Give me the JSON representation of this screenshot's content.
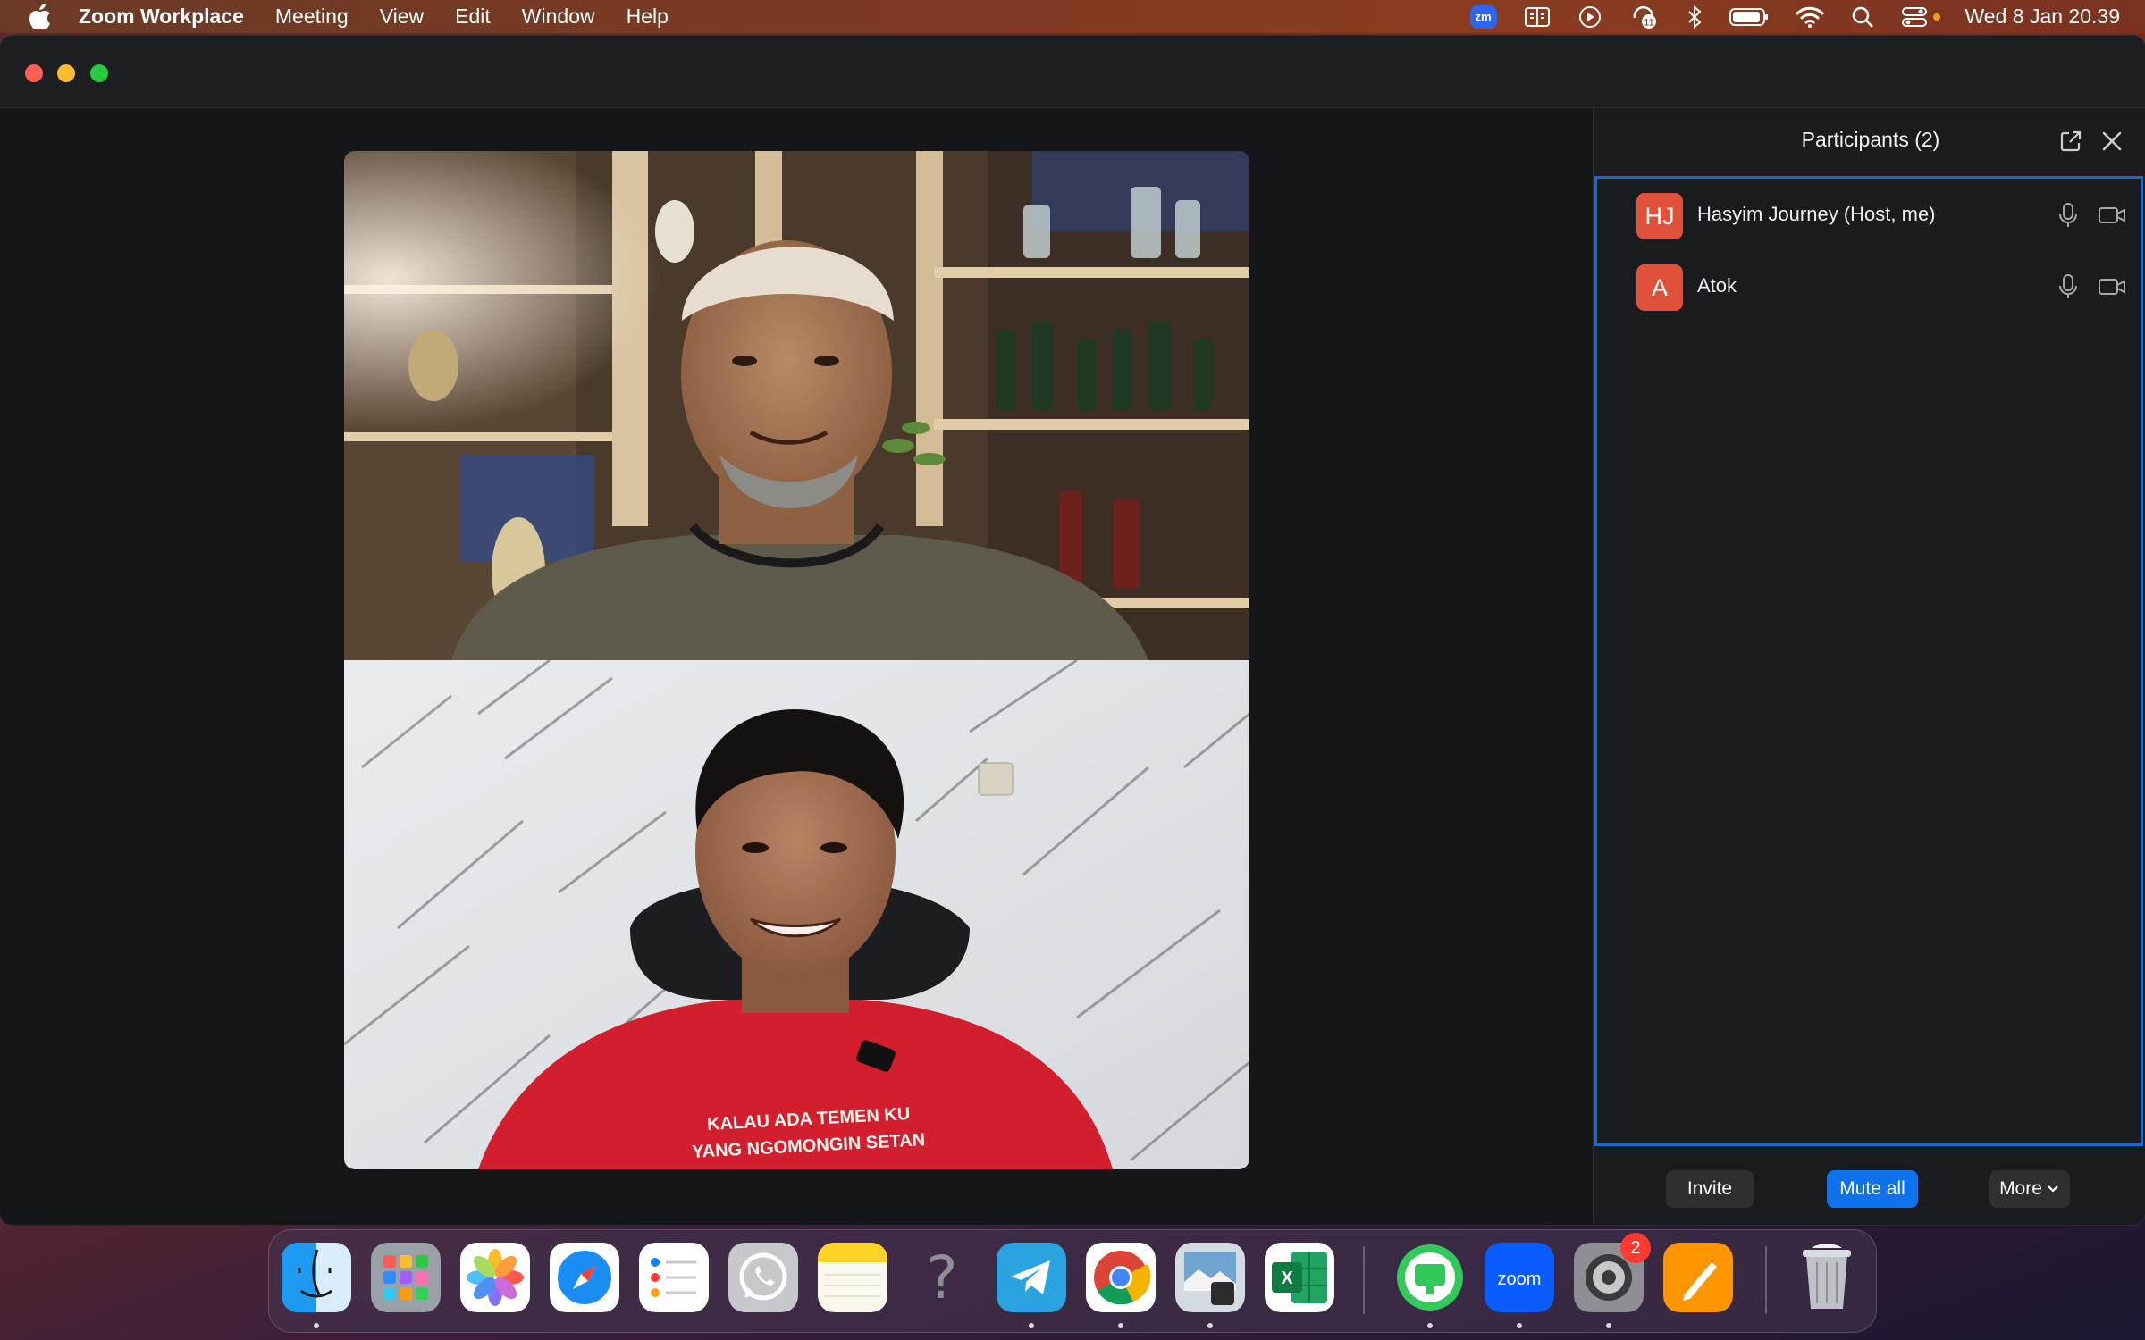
{
  "menubar": {
    "app_name": "Zoom Workplace",
    "items": [
      "Meeting",
      "View",
      "Edit",
      "Window",
      "Help"
    ],
    "clock": "Wed 8 Jan  20.39",
    "status_icons": [
      "zoom-status-icon",
      "display-mirror-icon",
      "play-icon",
      "notification-icon",
      "bluetooth-icon",
      "battery-icon",
      "wifi-icon",
      "search-icon",
      "control-center-icon"
    ],
    "zoom_badge": "zm",
    "notification_count": "11"
  },
  "window": {
    "traffic_lights": {
      "close": "#ff5f57",
      "minimize": "#febc2e",
      "zoom": "#28c840"
    }
  },
  "participants_panel": {
    "title": "Participants (2)",
    "participants": [
      {
        "initials": "HJ",
        "name": "Hasyim Journey (Host, me)",
        "avatar_color": "#e0513a"
      },
      {
        "initials": "A",
        "name": "Atok",
        "avatar_color": "#e0513a"
      }
    ],
    "buttons": {
      "invite": "Invite",
      "mute_all": "Mute all",
      "more": "More"
    }
  },
  "video": {
    "tshirt_text_line1": "KALAU ADA TEMEN KU",
    "tshirt_text_line2": "YANG NGOMONGIN SETAN"
  },
  "dock": {
    "apps": [
      "Finder",
      "Launchpad",
      "Photos",
      "Safari",
      "Reminders",
      "WhatsApp",
      "Notes",
      "Unknown",
      "Telegram",
      "Chrome",
      "Preview",
      "Excel",
      "Messages",
      "Zoom",
      "System Settings",
      "Pages",
      "Trash"
    ],
    "zoom_label": "zoom",
    "excel_label": "X",
    "system_settings_badge": "2"
  },
  "colors": {
    "accent": "#0e72ed",
    "panel_border": "#1b6ac9",
    "avatar": "#e0513a"
  }
}
